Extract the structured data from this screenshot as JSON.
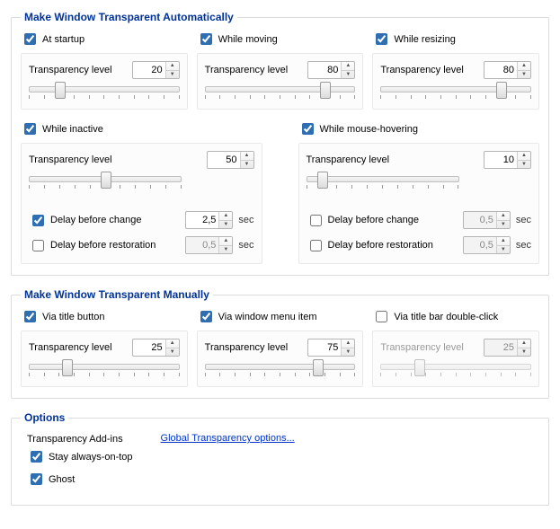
{
  "group_auto": {
    "legend": "Make Window Transparent Automatically",
    "startup": {
      "label": "At startup",
      "checked": true,
      "tl_label": "Transparency level",
      "tl_value": "20",
      "thumb": 20
    },
    "moving": {
      "label": "While moving",
      "checked": true,
      "tl_label": "Transparency level",
      "tl_value": "80",
      "thumb": 80
    },
    "resizing": {
      "label": "While resizing",
      "checked": true,
      "tl_label": "Transparency level",
      "tl_value": "80",
      "thumb": 80
    },
    "inactive": {
      "label": "While inactive",
      "checked": true,
      "tl_label": "Transparency level",
      "tl_value": "50",
      "thumb": 50,
      "delay_change": {
        "checked": true,
        "label": "Delay before change",
        "value": "2,5",
        "unit": "sec"
      },
      "delay_restore": {
        "checked": false,
        "label": "Delay before restoration",
        "value": "0,5",
        "unit": "sec"
      }
    },
    "hover": {
      "label": "While mouse-hovering",
      "checked": true,
      "tl_label": "Transparency level",
      "tl_value": "10",
      "thumb": 10,
      "delay_change": {
        "checked": false,
        "label": "Delay before change",
        "value": "0,5",
        "unit": "sec"
      },
      "delay_restore": {
        "checked": false,
        "label": "Delay before restoration",
        "value": "0,5",
        "unit": "sec"
      }
    }
  },
  "group_manual": {
    "legend": "Make Window Transparent Manually",
    "titlebtn": {
      "label": "Via title button",
      "checked": true,
      "tl_label": "Transparency level",
      "tl_value": "25",
      "thumb": 25
    },
    "menuitem": {
      "label": "Via window menu item",
      "checked": true,
      "tl_label": "Transparency level",
      "tl_value": "75",
      "thumb": 75
    },
    "dblclick": {
      "label": "Via title bar double-click",
      "checked": false,
      "tl_label": "Transparency level",
      "tl_value": "25",
      "thumb": 25
    }
  },
  "group_options": {
    "legend": "Options",
    "addins_title": "Transparency Add-ins",
    "stay_on_top": {
      "checked": true,
      "label": "Stay always-on-top"
    },
    "ghost": {
      "checked": true,
      "label": "Ghost"
    },
    "global_link": "Global Transparency options..."
  }
}
